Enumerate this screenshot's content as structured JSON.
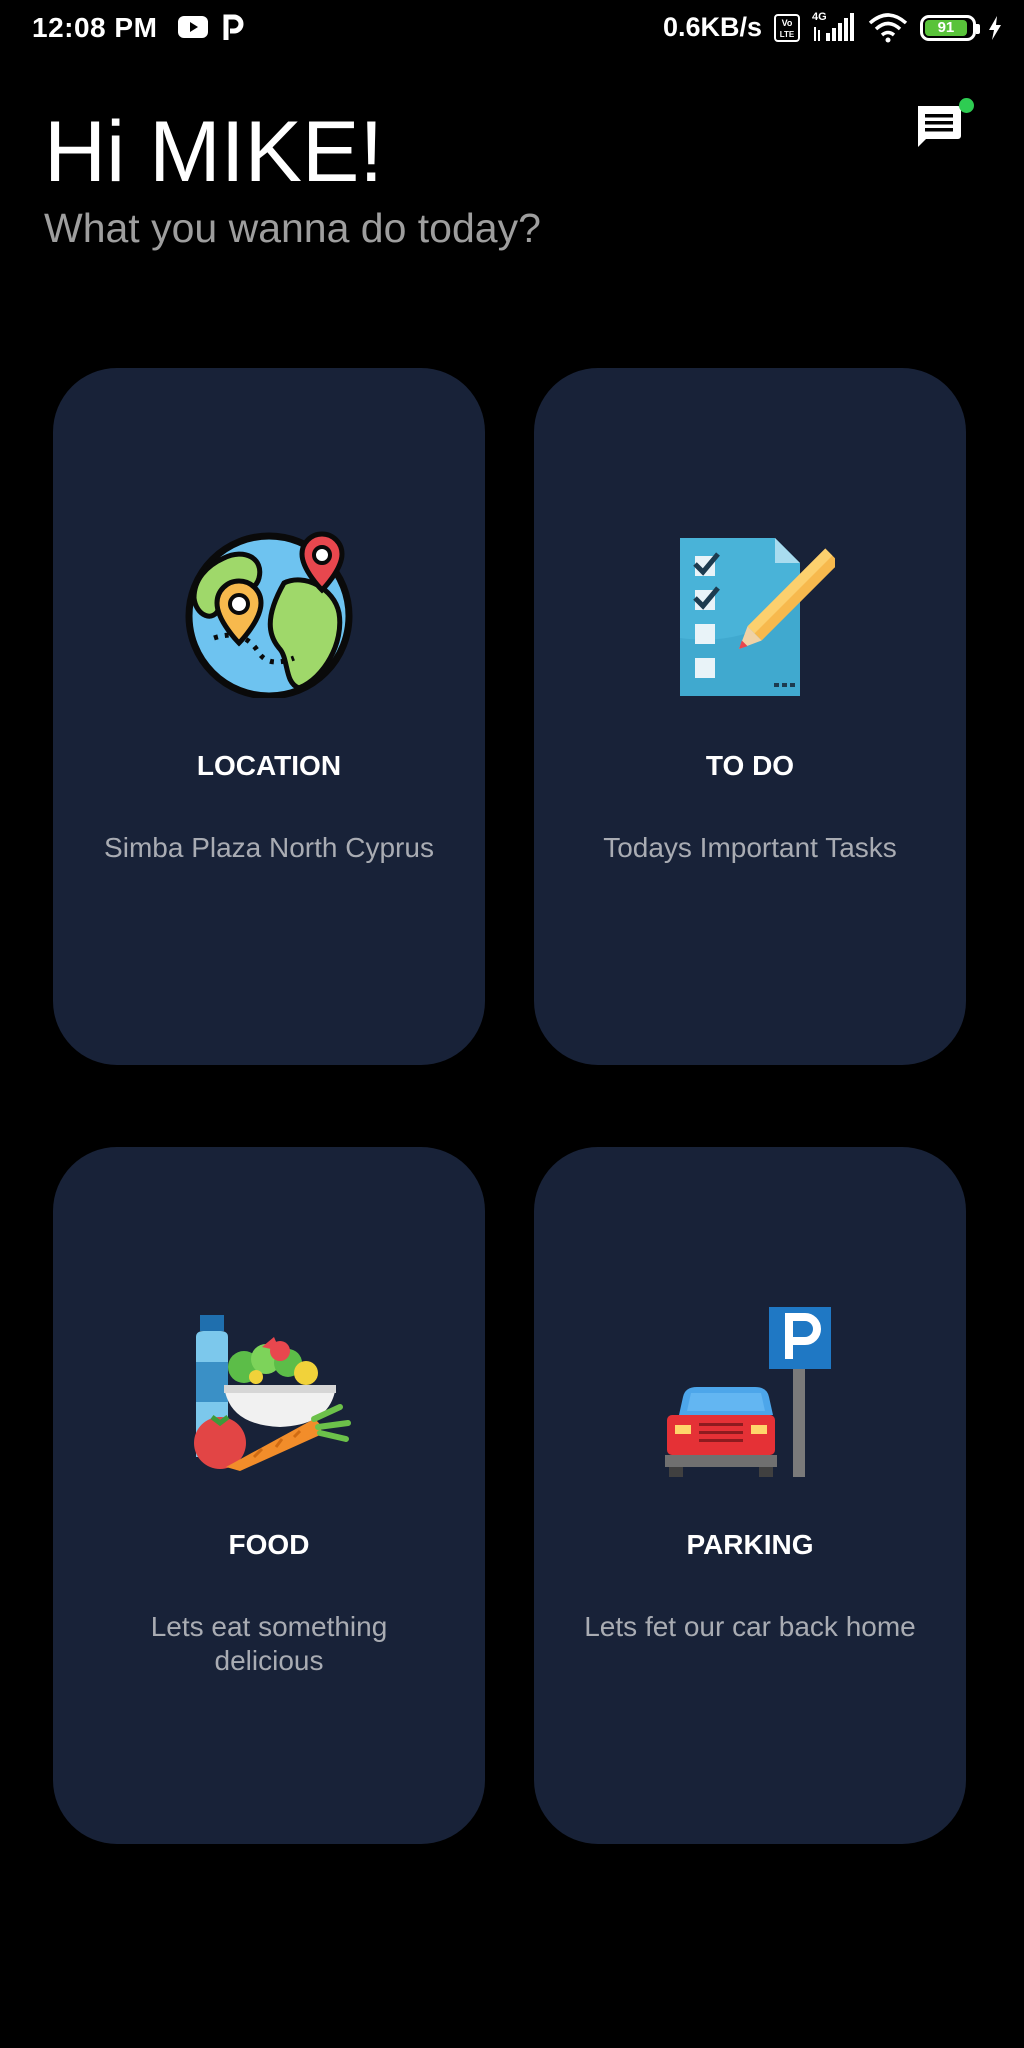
{
  "status_bar": {
    "time": "12:08 PM",
    "net_speed": "0.6KB/s",
    "network_type": "4G",
    "battery_level": "91",
    "icons": [
      "youtube-icon",
      "p-app-icon",
      "volte-icon",
      "signal-icon",
      "wifi-icon",
      "battery-icon",
      "charging-icon"
    ]
  },
  "header": {
    "greeting": "Hi MIKE!",
    "subtitle": "What you wanna do today?",
    "chat_icon": "chat-icon",
    "notification_color": "#2ecc52"
  },
  "cards": [
    {
      "title": "LOCATION",
      "description": "Simba Plaza North Cyprus",
      "icon": "globe-location-icon"
    },
    {
      "title": "TO DO",
      "description": "Todays Important Tasks",
      "icon": "checklist-icon"
    },
    {
      "title": "FOOD",
      "description": "Lets eat something delicious",
      "icon": "food-icon"
    },
    {
      "title": "PARKING",
      "description": "Lets fet our car back home",
      "icon": "parking-icon"
    }
  ],
  "colors": {
    "background": "#000000",
    "card": "#182238",
    "subtitle": "#9e9e9e",
    "card_description": "#a9acb3",
    "battery": "#59c33a"
  }
}
